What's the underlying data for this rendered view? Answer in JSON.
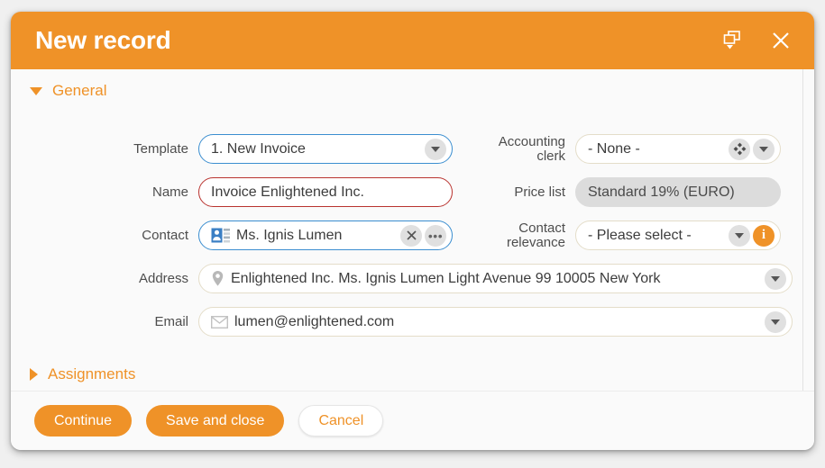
{
  "window": {
    "title": "New record",
    "restore_icon": "window-restore-dropdown-icon",
    "close_icon": "close-icon"
  },
  "sections": {
    "general": {
      "label": "General",
      "expanded": true,
      "caret_icon": "caret-down-icon"
    },
    "assignments": {
      "label": "Assignments",
      "expanded": false,
      "caret_icon": "caret-right-icon"
    }
  },
  "fields": {
    "template": {
      "label": "Template",
      "value": "1. New Invoice",
      "dropdown_icon": "caret-down-icon",
      "border_color": "#3b8ed0"
    },
    "name": {
      "label": "Name",
      "value": "Invoice Enlightened Inc.",
      "border_color": "#b9332f"
    },
    "contact": {
      "label": "Contact",
      "value": "Ms. Ignis Lumen",
      "lead_icon": "contact-card-icon",
      "clear_icon": "clear-x-icon",
      "more_icon": "ellipsis-icon",
      "border_color": "#3b8ed0"
    },
    "address": {
      "label": "Address",
      "value": "Enlightened Inc. Ms. Ignis Lumen Light Avenue 99 10005 New York",
      "lead_icon": "map-pin-icon",
      "dropdown_icon": "caret-down-icon"
    },
    "email": {
      "label": "Email",
      "value": "lumen@enlightened.com",
      "lead_icon": "envelope-icon",
      "dropdown_icon": "caret-down-icon"
    },
    "accounting_clerk": {
      "label": "Accounting clerk",
      "label_line1": "Accounting",
      "label_line2": "clerk",
      "value": "- None -",
      "picker_icon": "four-diamonds-icon",
      "dropdown_icon": "caret-down-icon"
    },
    "price_list": {
      "label": "Price list",
      "value": "Standard 19% (EURO)",
      "disabled": true
    },
    "contact_relevance": {
      "label": "Contact relevance",
      "label_line1": "Contact",
      "label_line2": "relevance",
      "value": "- Please select -",
      "dropdown_icon": "caret-down-icon",
      "info_icon": "info-icon"
    }
  },
  "footer": {
    "continue_label": "Continue",
    "save_close_label": "Save and close",
    "cancel_label": "Cancel"
  },
  "colors": {
    "accent": "#ef9228",
    "focus_blue": "#3b8ed0",
    "error_red": "#b9332f",
    "disabled_gray": "#dcdcdc"
  }
}
